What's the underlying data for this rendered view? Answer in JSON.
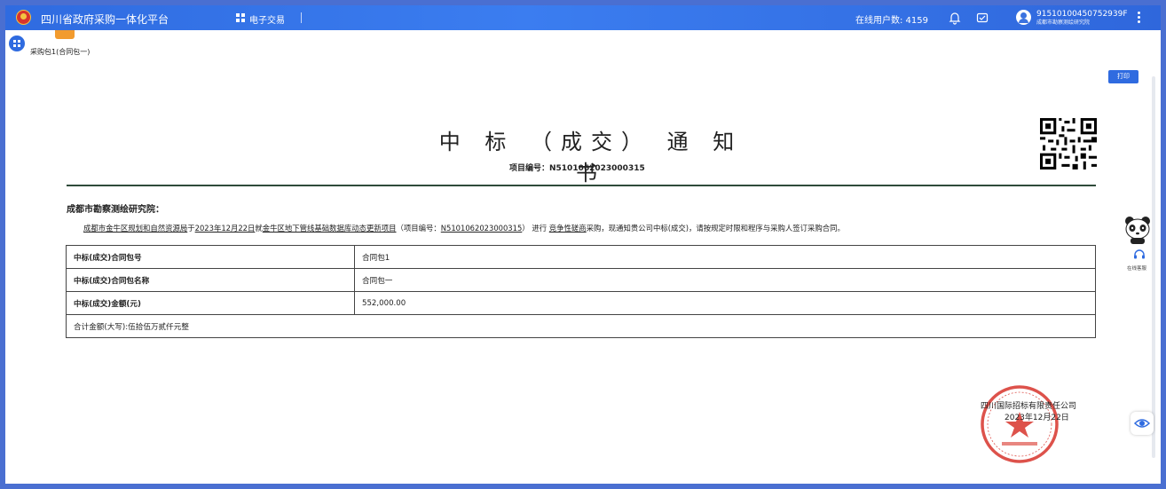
{
  "app": {
    "title": "四川省政府采购一体化平台",
    "menu_label": "电子交易",
    "online_users": "在线用户数: 4159",
    "user_id": "91510100450752939F",
    "user_org": "成都市勘察测绘研究院",
    "accent_color": "#2f6be0"
  },
  "subheader": {
    "package_label": "采购包1(合同包一)",
    "print_label": "打印"
  },
  "document": {
    "title": "中 标 （成交） 通 知 书",
    "project_no": "项目编号：N5101062023000315",
    "addressee": "成都市勘察测绘研究院：",
    "body": {
      "purchaser": "成都市金牛区规划和自然资源局",
      "t1": "于",
      "date": "2023年12月22日",
      "t2": "就",
      "project": "金牛区地下管线基础数据库动态更新项目",
      "paren_open": "（项目编号：",
      "project_no": "N5101062023000315",
      "paren_close": "）",
      "t3": "进行",
      "method": "竞争性磋商",
      "t4": "采购，现通知贵公司中标(成交)，请按规定时限和程序与采购人签订采购合同。"
    },
    "table": {
      "rows": [
        {
          "label": "中标(成交)合同包号",
          "value": "合同包1"
        },
        {
          "label": "中标(成交)合同包名称",
          "value": "合同包一"
        },
        {
          "label": "中标(成交)金额(元)",
          "value": "552,000.00"
        }
      ],
      "total": "合计金额(大写):伍拾伍万贰仟元整"
    },
    "issuer": "四川国际招标有限责任公司",
    "issue_date": "2023年12月22日",
    "seal_color": "#d8342c"
  },
  "widgets": {
    "cs_label": "在线客服"
  }
}
